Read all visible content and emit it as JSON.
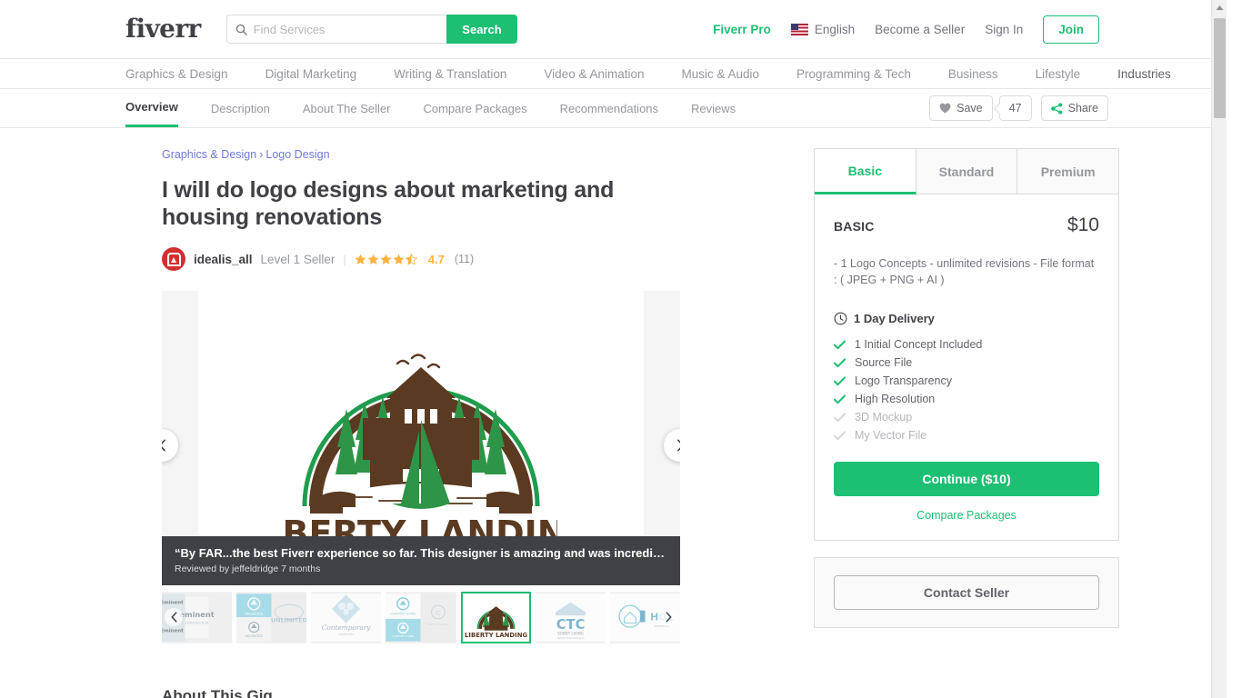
{
  "header": {
    "logo": "fiverr",
    "search": {
      "placeholder": "Find Services",
      "value": "",
      "button_label": "Search",
      "icon": "search-icon"
    },
    "pro_link": "Fiverr Pro",
    "language": "English",
    "become_seller": "Become a Seller",
    "sign_in": "Sign In",
    "join": "Join"
  },
  "catnav": {
    "items": [
      {
        "label": "Graphics & Design",
        "active": false
      },
      {
        "label": "Digital Marketing",
        "active": false
      },
      {
        "label": "Writing & Translation",
        "active": false
      },
      {
        "label": "Video & Animation",
        "active": false
      },
      {
        "label": "Music & Audio",
        "active": false
      },
      {
        "label": "Programming & Tech",
        "active": false
      },
      {
        "label": "Business",
        "active": false
      },
      {
        "label": "Lifestyle",
        "active": false
      },
      {
        "label": "Industries",
        "active": true
      }
    ]
  },
  "subnav": {
    "items": [
      {
        "label": "Overview"
      },
      {
        "label": "Description"
      },
      {
        "label": "About The Seller"
      },
      {
        "label": "Compare Packages"
      },
      {
        "label": "Recommendations"
      },
      {
        "label": "Reviews"
      }
    ],
    "active_index": 0,
    "save_label": "Save",
    "save_count": "47",
    "share_label": "Share"
  },
  "gig": {
    "breadcrumb": {
      "parent": "Graphics & Design",
      "separator": "›",
      "child": "Logo Design"
    },
    "title": "I will do logo designs about marketing and housing renovations",
    "seller": {
      "name": "idealis_all",
      "level": "Level 1 Seller",
      "rating": "4.7",
      "reviews_count": "(11)",
      "stars_full": 4,
      "stars_half": 1
    }
  },
  "gallery": {
    "logo_text": "LIBERTY LANDING",
    "prev_icon": "chevron-left-icon",
    "next_icon": "chevron-right-icon",
    "review": {
      "quote": "“By FAR...the best Fiverr experience so far. This designer is amazing and was incredibly resp...",
      "byline": "Reviewed by jeffeldridge 7 months"
    },
    "thumbnails": [
      {
        "name": "eminent-logo-thumb",
        "selected": false
      },
      {
        "name": "unlimited-logo-thumb",
        "selected": false
      },
      {
        "name": "contemporary-logo-thumb",
        "selected": false
      },
      {
        "name": "comfort-living-logo-thumb",
        "selected": false
      },
      {
        "name": "liberty-landing-logo-thumb",
        "selected": true
      },
      {
        "name": "ctc-sober-living-logo-thumb",
        "selected": false
      },
      {
        "name": "hol-logo-thumb",
        "selected": false
      }
    ]
  },
  "package": {
    "tabs": [
      {
        "label": "Basic"
      },
      {
        "label": "Standard"
      },
      {
        "label": "Premium"
      }
    ],
    "active_tab_index": 0,
    "name": "BASIC",
    "price": "$10",
    "description": "- 1 Logo Concepts - unlimited revisions - File format : ( JPEG + PNG + AI )",
    "delivery": "1 Day Delivery",
    "delivery_icon": "clock-icon",
    "features": [
      {
        "label": "1 Initial Concept Included",
        "included": true
      },
      {
        "label": "Source File",
        "included": true
      },
      {
        "label": "Logo Transparency",
        "included": true
      },
      {
        "label": "High Resolution",
        "included": true
      },
      {
        "label": "3D Mockup",
        "included": false
      },
      {
        "label": "My Vector File",
        "included": false
      }
    ],
    "continue_label": "Continue ($10)",
    "compare_label": "Compare Packages",
    "contact_label": "Contact Seller"
  },
  "about_section": {
    "title": "About This Gig"
  },
  "colors": {
    "brand_green": "#1dbf73",
    "text_dark": "#404145",
    "text_muted": "#95979d",
    "link_blue": "#6f7adb",
    "star_gold": "#ffb33e",
    "overlay_dark": "#404145"
  }
}
